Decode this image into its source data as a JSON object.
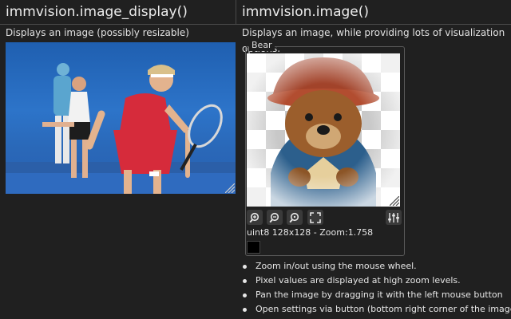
{
  "left": {
    "title": "immvision.image_display()",
    "description": "Displays an image (possibly resizable)"
  },
  "right": {
    "title": "immvision.image()",
    "description": "Displays an image, while providing lots of visualization options.",
    "group_label": "Bear",
    "image_info": "uint8 128x128 - Zoom:1.758",
    "toolbar": {
      "buttons": [
        "zoom-in-icon",
        "zoom-out-icon",
        "zoom-reset-icon",
        "fullscreen-icon",
        "settings-sliders-icon"
      ]
    },
    "bullets": [
      "Zoom in/out using the mouse wheel.",
      "Pixel values are displayed at high zoom levels.",
      "Pan the image by dragging it with the left mouse button",
      "Open settings via button (bottom right corner of the image)"
    ]
  },
  "colors": {
    "background": "#202020",
    "text": "#e6e6e6",
    "divider": "#4a4a4a",
    "button": "#3a3a3a"
  }
}
